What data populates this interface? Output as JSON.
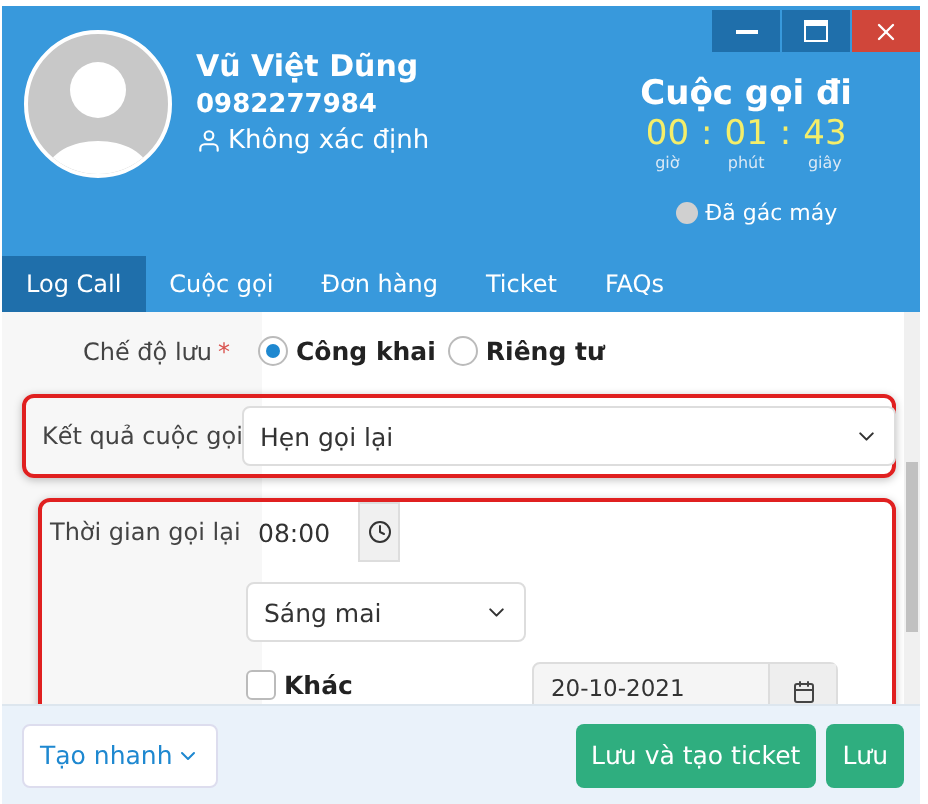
{
  "caller": {
    "name": "Vũ Việt Dũng",
    "phone": "0982277984",
    "group": "Không xác định"
  },
  "call": {
    "title": "Cuộc gọi đi",
    "timer": [
      {
        "value": "00",
        "unit": "giờ"
      },
      {
        "value": "01",
        "unit": "phút"
      },
      {
        "value": "43",
        "unit": "giây"
      }
    ],
    "separator": ":",
    "status": "Đã gác máy",
    "status_on": false
  },
  "tabs": [
    {
      "label": "Log Call",
      "selected": true
    },
    {
      "label": "Cuộc gọi",
      "selected": false
    },
    {
      "label": "Đơn hàng",
      "selected": false
    },
    {
      "label": "Ticket",
      "selected": false
    },
    {
      "label": "FAQs",
      "selected": false
    }
  ],
  "form": {
    "save_mode": {
      "label": "Chế độ lưu",
      "required_mark": "*",
      "options": [
        {
          "label": "Công khai",
          "selected": true
        },
        {
          "label": "Riêng tư",
          "selected": false
        }
      ]
    },
    "result": {
      "label": "Kết quả cuộc gọi",
      "value": "Hẹn gọi lại",
      "highlighted": true
    },
    "callback": {
      "label": "Thời gian gọi lại",
      "time": "08:00",
      "preset": "Sáng mai",
      "other": {
        "label": "Khác",
        "checked": false
      },
      "date": "20-10-2021",
      "highlighted": true
    }
  },
  "footer": {
    "quick_create": "Tạo nhanh",
    "buttons": [
      "Lưu và tạo ticket",
      "Lưu"
    ]
  }
}
